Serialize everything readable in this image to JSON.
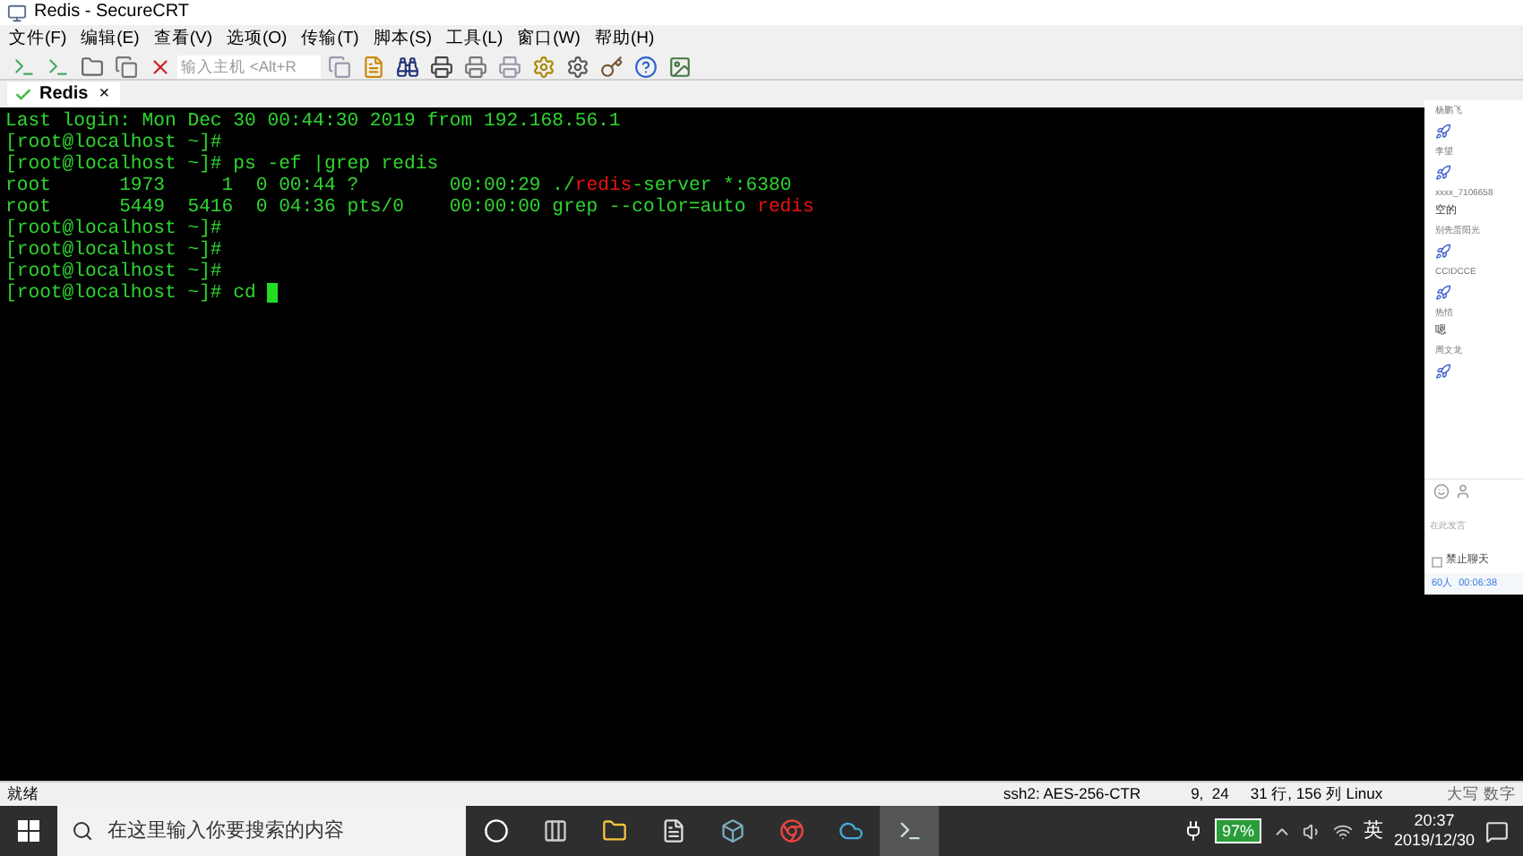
{
  "window": {
    "title": "Redis - SecureCRT"
  },
  "menu": [
    "文件(F)",
    "编辑(E)",
    "查看(V)",
    "选项(O)",
    "传输(T)",
    "脚本(S)",
    "工具(L)",
    "窗口(W)",
    "帮助(H)"
  ],
  "toolbar": {
    "host_field": {
      "placeholder": "输入主机 <Alt+R"
    }
  },
  "tabs": [
    {
      "label": "Redis",
      "selected": true,
      "close": "×"
    }
  ],
  "terminal": {
    "lines": [
      {
        "segments": [
          {
            "kind": "normal",
            "text": "Last login: Mon Dec 30 00:44:30 2019 from 192.168.56.1"
          }
        ]
      },
      {
        "segments": [
          {
            "kind": "normal",
            "text": "[root@localhost ~]#"
          }
        ]
      },
      {
        "segments": [
          {
            "kind": "normal",
            "text": "[root@localhost ~]# ps -ef |grep redis"
          }
        ]
      },
      {
        "segments": [
          {
            "kind": "normal",
            "text": "root      1973     1  0 00:44 ?        00:00:29 ./"
          },
          {
            "kind": "match",
            "text": "redis"
          },
          {
            "kind": "normal",
            "text": "-server *:6380"
          }
        ]
      },
      {
        "segments": [
          {
            "kind": "normal",
            "text": "root      5449  5416  0 04:36 pts/0    00:00:00 grep --color=auto "
          },
          {
            "kind": "match",
            "text": "redis"
          }
        ]
      },
      {
        "segments": [
          {
            "kind": "normal",
            "text": "[root@localhost ~]#"
          }
        ]
      },
      {
        "segments": [
          {
            "kind": "normal",
            "text": "[root@localhost ~]#"
          }
        ]
      },
      {
        "segments": [
          {
            "kind": "normal",
            "text": "[root@localhost ~]#"
          }
        ]
      },
      {
        "segments": [
          {
            "kind": "normal",
            "text": "[root@localhost ~]# cd "
          }
        ],
        "cursor": true
      }
    ]
  },
  "status_bar": {
    "state": "就绪",
    "cipher": "ssh2: AES-256-CTR",
    "position": "9,  24",
    "size": "31 行, 156 列 Linux",
    "keys": "大写 数字"
  },
  "chat_panel": {
    "messages": [
      {
        "name": "杨鹏飞",
        "kind": "rocket"
      },
      {
        "name": "李望",
        "kind": "rocket"
      },
      {
        "name": "xxxx_7106658",
        "kind": "text",
        "text": "空的"
      },
      {
        "name": "别先蛋阳光",
        "kind": "rocket"
      },
      {
        "name": "CCIDCCE",
        "kind": "rocket"
      },
      {
        "name": "热情",
        "kind": "text",
        "text": "嗯"
      },
      {
        "name": "周文龙",
        "kind": "rocket"
      }
    ],
    "input": {
      "placeholder": "在此发言"
    },
    "mute": {
      "label": "禁止聊天",
      "checked": false
    },
    "online": "60人",
    "duration": "00:06:38"
  },
  "taskbar": {
    "search": {
      "placeholder": "在这里输入你要搜索的内容"
    },
    "battery": "97%",
    "ime": "英",
    "time": "20:37",
    "date": "2019/12/30"
  }
}
